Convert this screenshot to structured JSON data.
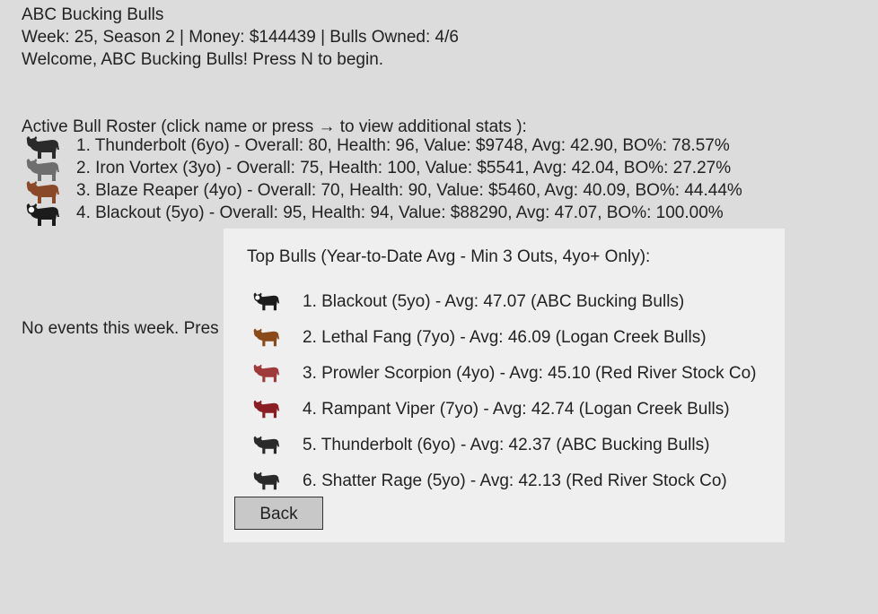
{
  "header": {
    "title": "ABC Bucking Bulls",
    "status": "Week: 25, Season 2 | Money: $144439 | Bulls Owned: 4/6",
    "welcome": "Welcome, ABC Bucking Bulls! Press N to begin."
  },
  "roster": {
    "heading": "Active Bull Roster (click name or press → to view additional stats ):",
    "bulls": [
      {
        "text": "1. Thunderbolt (6yo) - Overall: 80, Health: 96, Value: $9748, Avg: 42.90, BO%: 78.57%",
        "color": "#2a2a2a",
        "icon": "black-bull-icon"
      },
      {
        "text": "2. Iron Vortex (3yo) - Overall: 75, Health: 100, Value: $5541, Avg: 42.04, BO%: 27.27%",
        "color": "#6e6e6e",
        "icon": "gray-bull-icon"
      },
      {
        "text": "3. Blaze Reaper (4yo) - Overall: 70, Health: 90, Value: $5460, Avg: 40.09, BO%: 44.44%",
        "color": "#8a4a2a",
        "icon": "brown-bull-icon"
      },
      {
        "text": "4. Blackout (5yo) - Overall: 95, Health: 94, Value: $88290, Avg: 47.07, BO%: 100.00%",
        "color": "#1c1c1c",
        "icon": "black-bull-icon",
        "face": "#ffffff"
      }
    ]
  },
  "events": {
    "text": "No events this week. Pres"
  },
  "top_bulls": {
    "title": "Top Bulls (Year-to-Date Avg - Min 3 Outs, 4yo+ Only):",
    "rows": [
      {
        "text": "1. Blackout (5yo) - Avg: 47.07 (ABC Bucking Bulls)",
        "color": "#1c1c1c",
        "face": "#ffffff"
      },
      {
        "text": "2. Lethal Fang (7yo) - Avg: 46.09 (Logan Creek Bulls)",
        "color": "#8a4a1a"
      },
      {
        "text": "3. Prowler Scorpion (4yo) - Avg: 45.10 (Red River Stock Co)",
        "color": "#a03a3a"
      },
      {
        "text": "4. Rampant Viper (7yo) - Avg: 42.74 (Logan Creek Bulls)",
        "color": "#8a1e24"
      },
      {
        "text": "5. Thunderbolt (6yo) - Avg: 42.37 (ABC Bucking Bulls)",
        "color": "#2a2a2a"
      },
      {
        "text": "6. Shatter Rage (5yo) - Avg: 42.13 (Red River Stock Co)",
        "color": "#2a2a2a"
      }
    ],
    "back_label": "Back"
  }
}
